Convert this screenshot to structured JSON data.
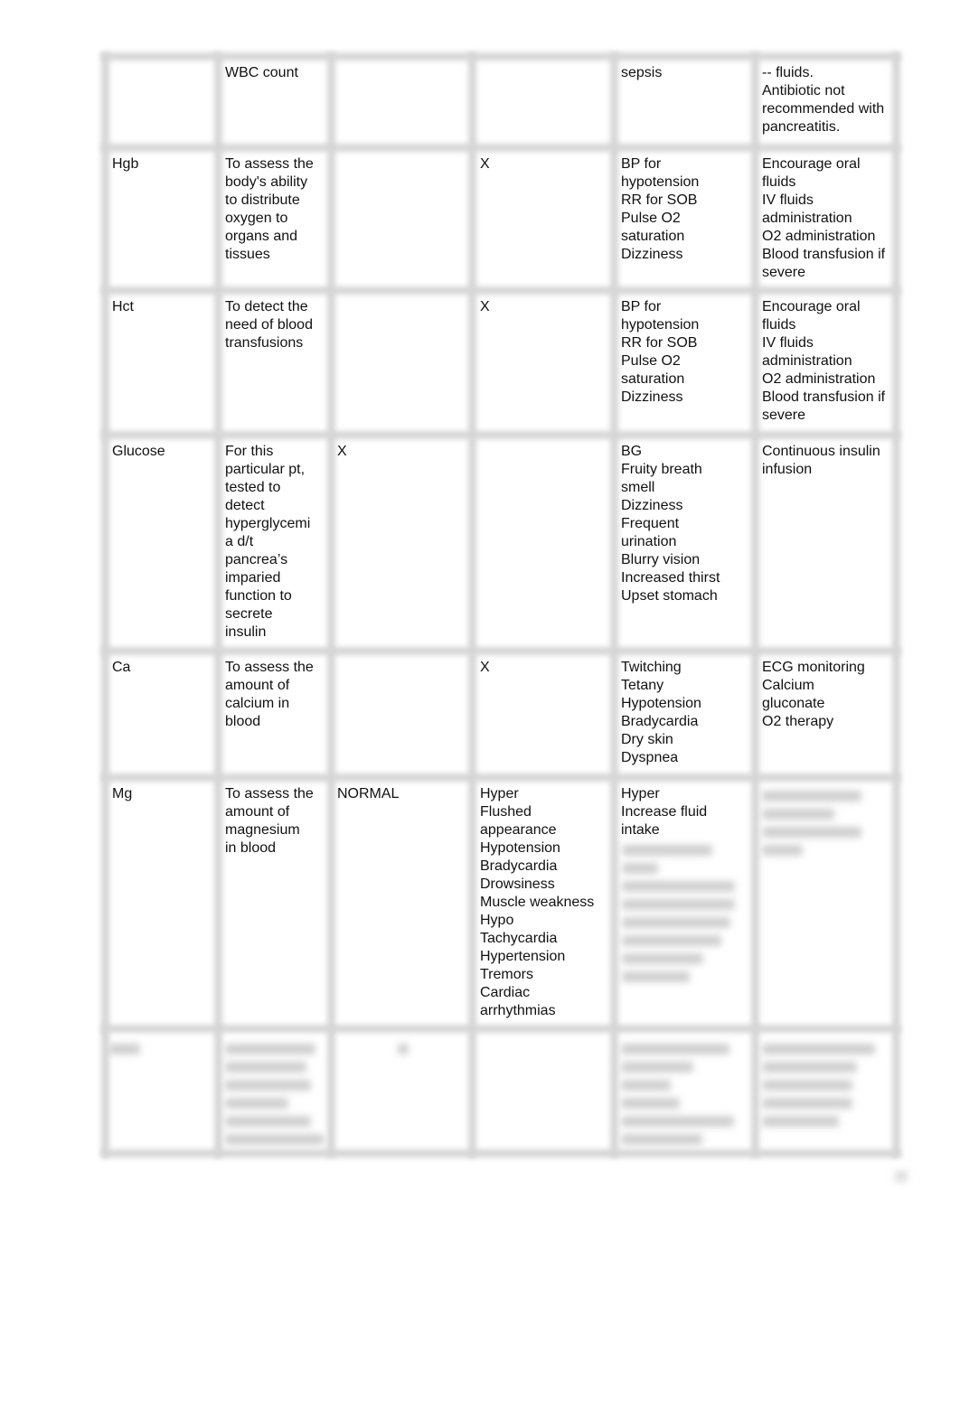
{
  "table": {
    "rows": [
      {
        "cells": [
          "",
          "WBC count",
          "",
          "",
          "sepsis",
          "-- fluids.\nAntibiotic not\nrecommended with\npancreatitis."
        ]
      },
      {
        "cells": [
          "Hgb",
          "To assess the\nbody's ability\nto distribute\noxygen to\norgans and\ntissues",
          "",
          "X",
          "BP for\nhypotension\nRR for SOB\nPulse O2\nsaturation\nDizziness",
          "Encourage oral\nfluids\nIV fluids\nadministration\nO2 administration\nBlood transfusion if\nsevere"
        ]
      },
      {
        "cells": [
          "Hct",
          "To detect the\nneed of blood\ntransfusions",
          "",
          "X",
          "BP for\nhypotension\nRR for SOB\nPulse O2\nsaturation\nDizziness",
          "Encourage oral\nfluids\nIV fluids\nadministration\nO2 administration\nBlood transfusion if\nsevere"
        ]
      },
      {
        "cells": [
          "Glucose",
          "For this\nparticular pt,\ntested to\ndetect\nhyperglycemi\na d/t\npancrea’s\nimparied\nfunction to\nsecrete\ninsulin",
          "X",
          "",
          "BG\nFruity breath\nsmell\nDizziness\nFrequent\nurination\nBlurry vision\nIncreased thirst\nUpset stomach",
          "Continuous insulin\ninfusion"
        ]
      },
      {
        "cells": [
          "Ca",
          "To assess the\namount of\ncalcium in\nblood",
          "",
          "X",
          "Twitching\nTetany\nHypotension\nBradycardia\nDry skin\nDyspnea",
          "ECG monitoring\nCalcium\ngluconate\nO2 therapy"
        ]
      },
      {
        "cells": [
          "Mg",
          "To assess the\namount of\nmagnesium\nin blood",
          "NORMAL",
          " Hyper\nFlushed\n appearance\nHypotension\nBradycardia\nDrowsiness\nMuscle weakness\n Hypo\nTachycardia\nHypertension\nTremors\n Cardiac\n arrhythmias",
          "Hyper\nIncrease fluid\nintake",
          ""
        ]
      }
    ]
  }
}
